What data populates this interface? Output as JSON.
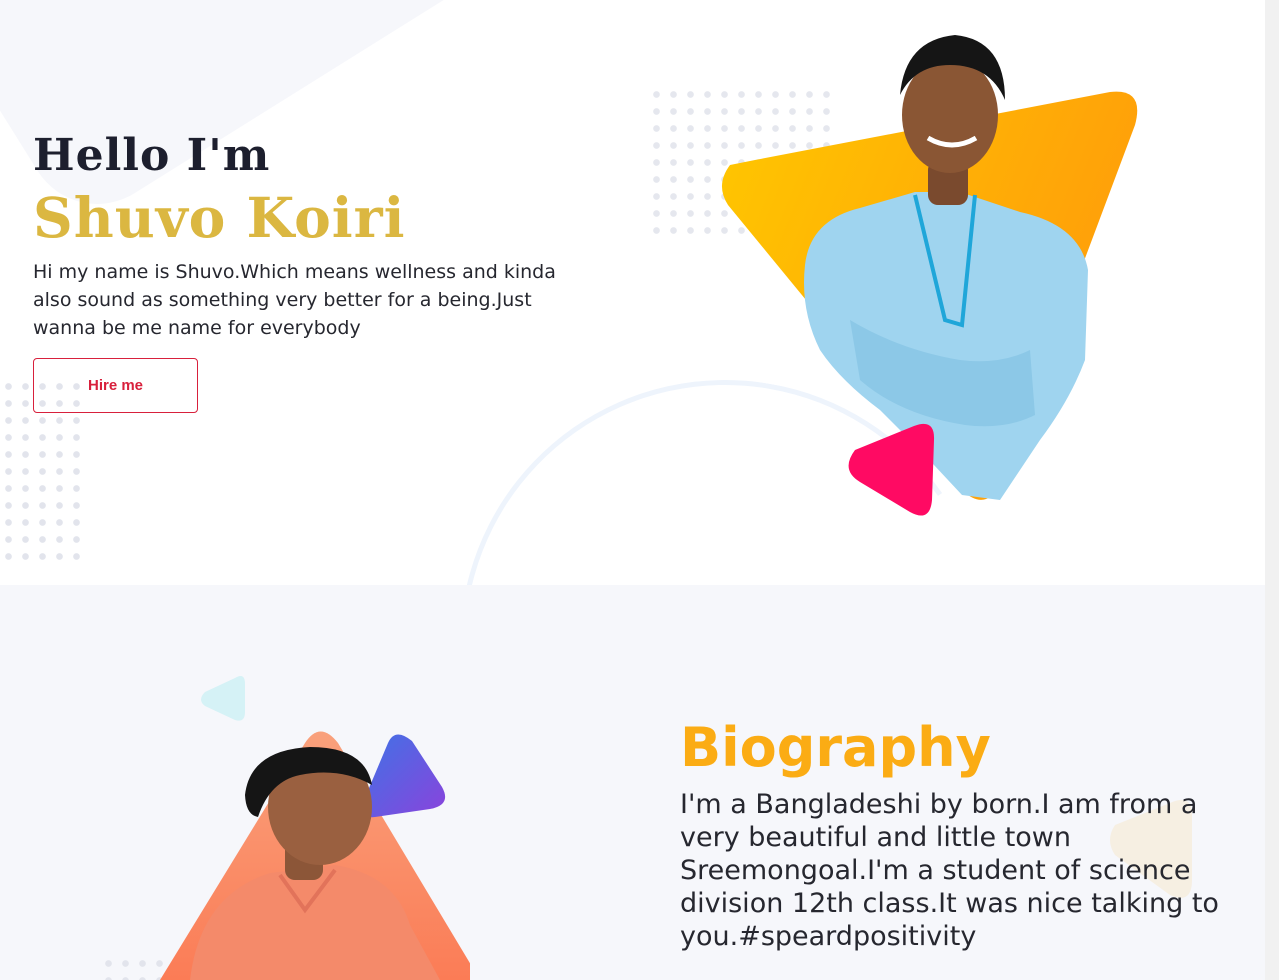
{
  "hero": {
    "greeting": "Hello I'm",
    "name": "Shuvo Koiri",
    "description": "Hi my name is Shuvo.Which means wellness and kinda also sound as something very better for a being.Just wanna be me name for everybody",
    "hire_button_label": "Hire me"
  },
  "biography": {
    "title": "Biography",
    "text": "I'm a Bangladeshi by born.I am from a very beautiful and little town Sreemongoal.I'm a student of science division 12th class.It was nice talking to you.#speardpositivity"
  },
  "colors": {
    "name_gold": "#dbb741",
    "heading_dark": "#1d1f2e",
    "button_red": "#d8203c",
    "bio_title_orange": "#fbac14",
    "triangle_yellow": "#ffc107",
    "triangle_pink": "#ff0a63",
    "triangle_coral": "#fb8a6a",
    "triangle_blue": "#5b5ce3",
    "triangle_cyan": "#c8f0f4",
    "section_bg": "#f6f7fb"
  }
}
